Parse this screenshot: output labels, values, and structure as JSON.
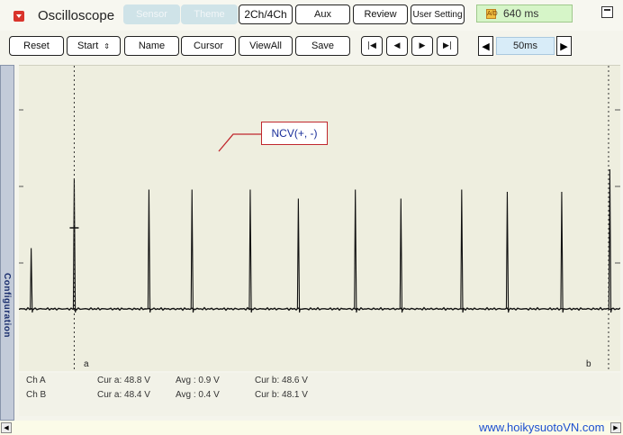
{
  "app": {
    "title": "Oscilloscope"
  },
  "top_buttons": {
    "sensor": "Sensor",
    "theme": "Theme",
    "channels": "2Ch/4Ch",
    "aux": "Aux",
    "review": "Review",
    "user_setting": "User Setting"
  },
  "status": {
    "sample_icon": "A/D",
    "time_value": "640 ms"
  },
  "toolbar": {
    "reset": "Reset",
    "start": "Start",
    "name": "Name",
    "cursor": "Cursor",
    "view_all": "ViewAll",
    "save": "Save"
  },
  "nav_icons": [
    "skip-to-start-icon",
    "step-back-icon",
    "step-forward-icon",
    "skip-to-end-icon"
  ],
  "timebase": {
    "value": "50ms"
  },
  "side_tab": {
    "label": "Configuration"
  },
  "plot": {
    "annotation": "NCV(+, -)",
    "cursor_a_label": "a",
    "cursor_b_label": "b",
    "trace_color": "#111111",
    "annotation_color": "#c0272d",
    "spike_times": [
      0.04,
      0.38,
      0.97,
      1.31,
      1.77,
      2.15,
      2.6,
      2.96,
      3.44,
      3.8,
      4.23,
      4.61
    ],
    "spike_levels": [
      0.27,
      0.58,
      0.53,
      0.53,
      0.53,
      0.49,
      0.53,
      0.49,
      0.53,
      0.52,
      0.52,
      0.62
    ],
    "cursor_a_time": 0.38,
    "cursor_b_time": 4.6,
    "time_span": 4.65
  },
  "readouts": [
    {
      "channel": "Ch A",
      "cur_a": "Cur a: 48.8 V",
      "avg": "Avg : 0.9 V",
      "cur_b": "Cur b: 48.6 V"
    },
    {
      "channel": "Ch B",
      "cur_a": "Cur a: 48.4 V",
      "avg": "Avg : 0.4 V",
      "cur_b": "Cur b: 48.1 V"
    }
  ],
  "watermark": "www.hoikysuotoVN.com"
}
